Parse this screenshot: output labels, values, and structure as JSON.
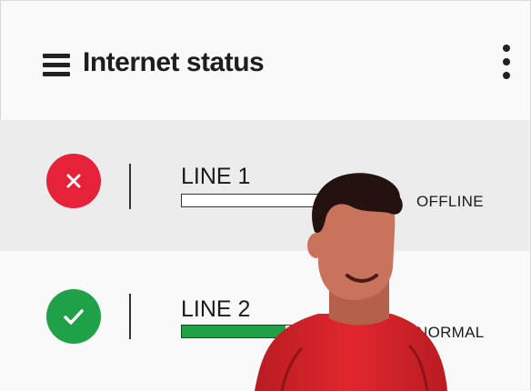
{
  "header": {
    "menu_icon": "hamburger-menu-icon",
    "title": "Internet status",
    "more_icon": "vertical-dots-icon"
  },
  "lines": [
    {
      "label": "LINE 1",
      "status": "OFFLINE",
      "state_icon": "x-icon",
      "state_color": "#e5223a",
      "progress": 0.0
    },
    {
      "label": "LINE 2",
      "status": "NORMAL",
      "state_icon": "check-icon",
      "state_color": "#1fa148",
      "progress": 0.5
    }
  ],
  "colors": {
    "offline": "#e5223a",
    "normal": "#1fa148",
    "row_highlight": "#ececec"
  }
}
